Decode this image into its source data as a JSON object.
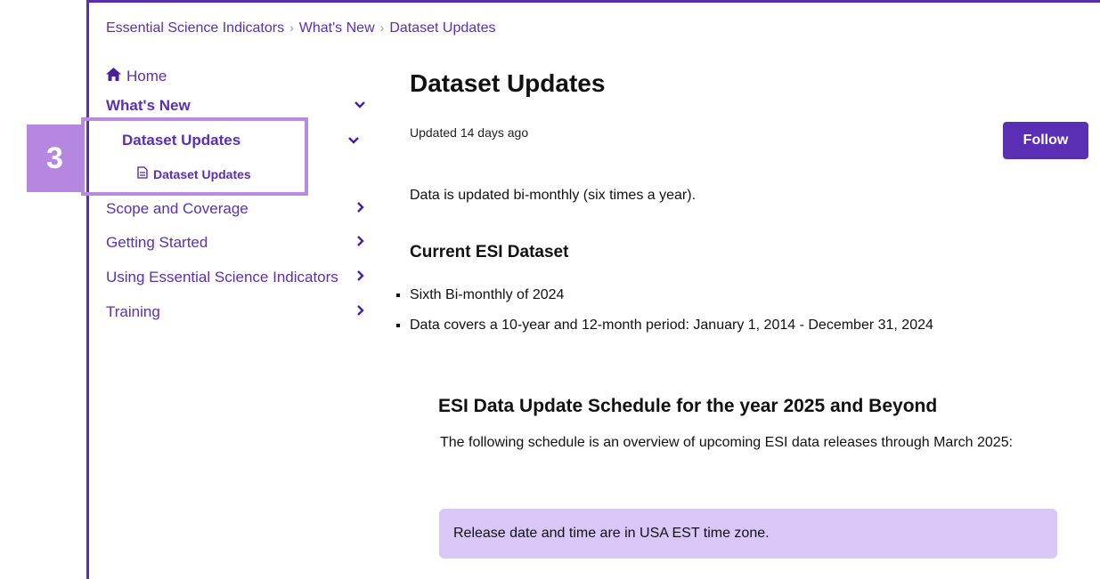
{
  "breadcrumb": {
    "items": [
      "Essential Science Indicators",
      "What's New",
      "Dataset Updates"
    ],
    "separator": "›"
  },
  "sidebar": {
    "home": "Home",
    "whats_new": "What's New",
    "dataset_updates": "Dataset Updates",
    "dataset_updates_sub": "Dataset Updates",
    "items": [
      {
        "label": "Scope and Coverage"
      },
      {
        "label": "Getting Started"
      },
      {
        "label": "Using Essential Science Indicators"
      },
      {
        "label": "Training"
      }
    ]
  },
  "annotation": {
    "step": "3"
  },
  "article": {
    "title": "Dataset Updates",
    "updated": "Updated 14 days ago",
    "follow_label": "Follow",
    "intro": "Data is updated bi-monthly (six times a year).",
    "current_title": "Current ESI Dataset",
    "bullets": [
      "Sixth Bi-monthly of 2024",
      "Data covers a 10-year and 12-month period: January 1, 2014 - December 31, 2024"
    ],
    "schedule_title": "ESI Data Update Schedule for the year 2025 and Beyond",
    "schedule_text": "The following schedule is an overview of upcoming ESI data releases through March 2025:",
    "note": "Release date and time are in USA EST time zone."
  },
  "colors": {
    "brand": "#5b2fb3",
    "highlight": "#b687e0",
    "note_bg": "#d9c7f7"
  }
}
